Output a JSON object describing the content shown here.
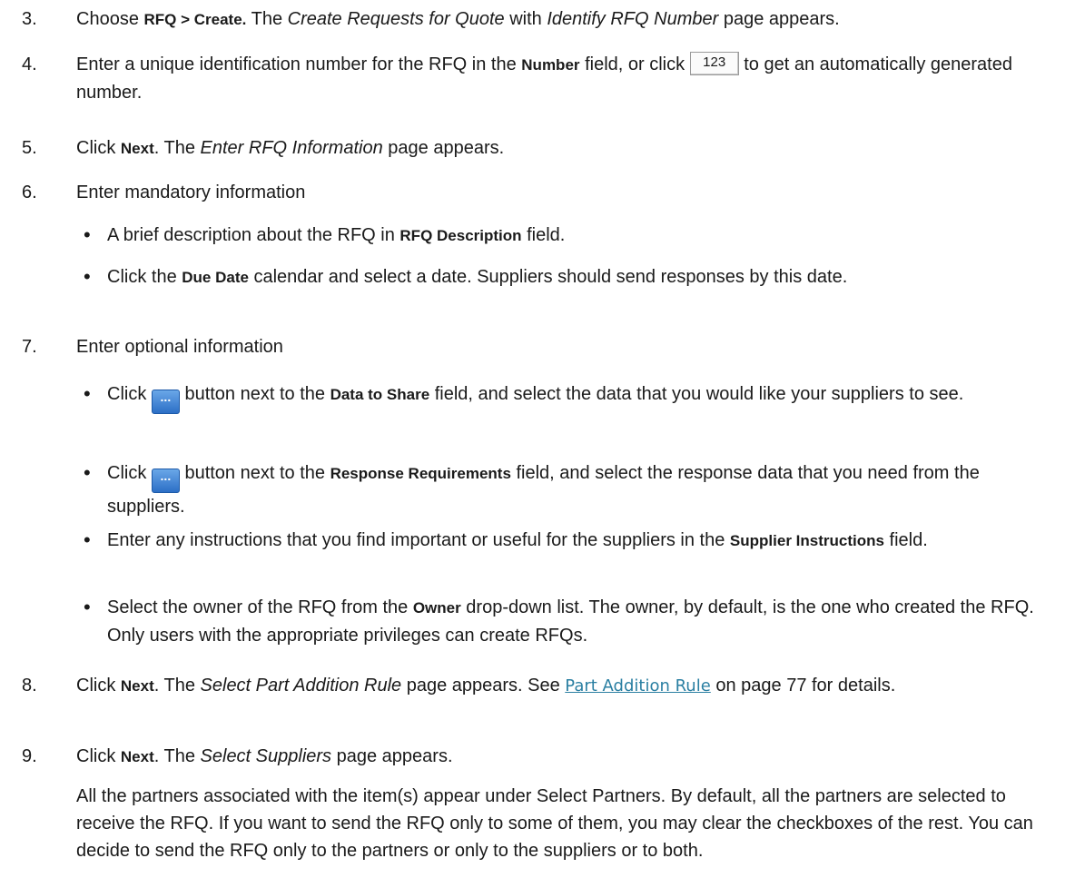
{
  "step3": {
    "num": "3.",
    "t1": "Choose ",
    "b1": "RFQ > Create.",
    "t2": " The ",
    "i1": "Create Requests for Quote",
    "t3": " with ",
    "i2": "Identify RFQ Number",
    "t4": " page appears."
  },
  "step4": {
    "num": "4.",
    "t1": "Enter a unique identification number for the RFQ in the ",
    "b1": "Number",
    "t2": " field, or click ",
    "button_label": "123",
    "t3": " to get an automatically generated number."
  },
  "step5": {
    "num": "5.",
    "t1": "Click ",
    "b1": "Next",
    "t2": ". The ",
    "i1": "Enter RFQ Information",
    "t3": " page appears."
  },
  "step6": {
    "num": "6.",
    "text": "Enter mandatory information",
    "bullet_glyph": "•",
    "bullet1": {
      "t1": "A brief description about the RFQ in ",
      "b1": "RFQ Description",
      "t2": " field."
    },
    "bullet2": {
      "t1": "Click the ",
      "b1": "Due Date",
      "t2": " calendar and select a date. Suppliers should send responses by this date."
    }
  },
  "step7": {
    "num": "7.",
    "text": "Enter optional information",
    "button_glyph": "...",
    "bullet1": {
      "t1": "Click ",
      "t2": " button next to the ",
      "b1": "Data to Share",
      "t3": " field, and select the data that you would like your suppliers to see."
    },
    "bullet2": {
      "t1": "Click ",
      "t2": " button next to the ",
      "b1": "Response Requirements",
      "t3": " field, and select the response data that you need from the suppliers."
    },
    "bullet3": {
      "t1": "Enter any instructions that you find important or useful for the suppliers in the ",
      "b1": "Supplier Instructions",
      "t2": " field."
    },
    "bullet4": {
      "t1": "Select the owner of the RFQ from the ",
      "b1": "Owner",
      "t2": " drop-down list. The owner, by default, is the one who created the RFQ. Only users with the appropriate privileges can create RFQs."
    }
  },
  "step8": {
    "num": "8.",
    "t1": "Click ",
    "b1": "Next",
    "t2": ". The ",
    "i1": "Select Part Addition Rule",
    "t3": " page appears. See ",
    "link": "Part Addition Rule",
    "t4": " on page 77 for details."
  },
  "step9": {
    "num": "9.",
    "t1": "Click ",
    "b1": "Next",
    "t2": ". The ",
    "i1": "Select Suppliers",
    "t3": " page appears."
  },
  "paragraph": "All the partners associated with the item(s) appear under Select Partners. By default, all the partners are selected to receive the RFQ. If you want to send the RFQ only to some of them, you may clear the checkboxes of the rest. You can decide to send the RFQ only to the partners or only to the suppliers or to both."
}
